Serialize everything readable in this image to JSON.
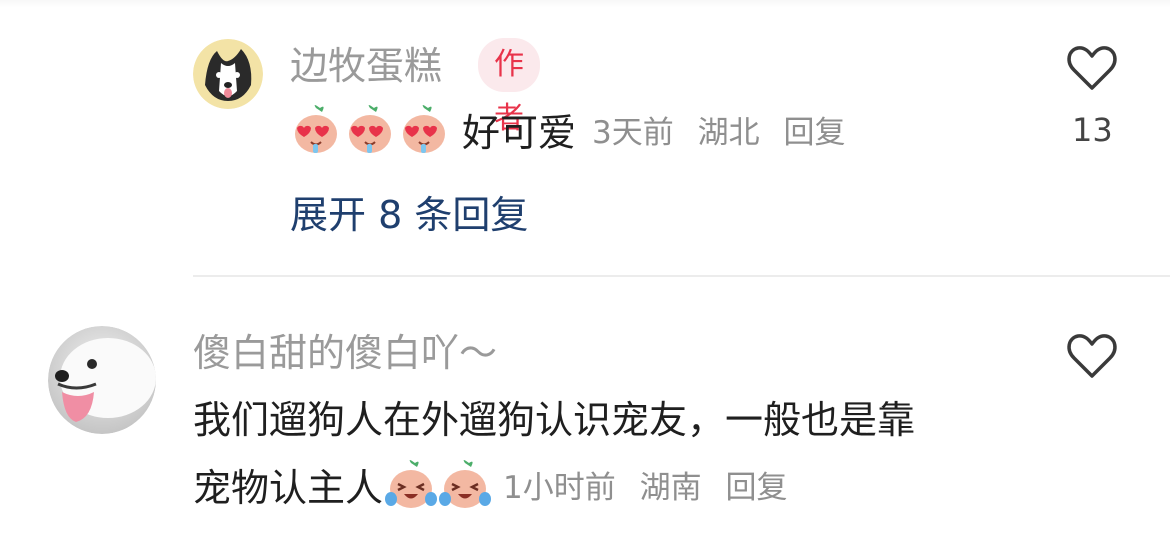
{
  "comment1": {
    "username": "边牧蛋糕",
    "badge": "作者",
    "text": "好可爱",
    "time": "3天前",
    "location": "湖北",
    "reply_label": "回复",
    "like_count": "13",
    "emoji_name": "heart-eyes-emoji",
    "emoji_count": 3
  },
  "expand_replies": "展开 8 条回复",
  "comment2": {
    "username": "傻白甜的傻白吖～",
    "text_line1": "我们遛狗人在外遛狗认识宠友，一般也是靠",
    "text_line2": "宠物认主人",
    "time": "1小时前",
    "location": "湖南",
    "reply_label": "回复",
    "emoji_name": "laughing-tears-emoji",
    "emoji_count": 2
  },
  "colors": {
    "badge_text": "#e8334a",
    "badge_bg": "#fbe9ec",
    "expand_link": "#1f3f6e"
  }
}
